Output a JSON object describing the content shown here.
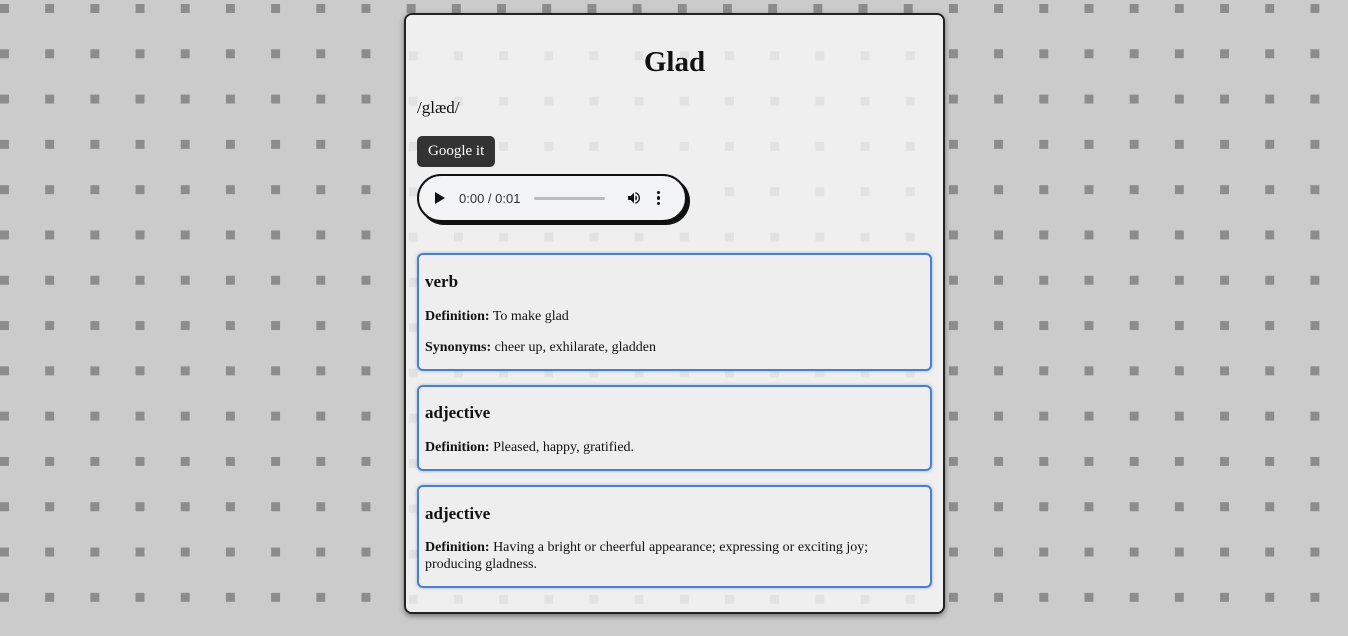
{
  "entry": {
    "word": "Glad",
    "phonetic": "/glæd/",
    "google_button": "Google it"
  },
  "audio": {
    "time": "0:00 / 0:01",
    "progress": 0.0
  },
  "meanings": [
    {
      "part_of_speech": "verb",
      "definition_label": "Definition:",
      "definition": "To make glad",
      "synonyms_label": "Synonyms:",
      "synonyms": "cheer up, exhilarate, gladden"
    },
    {
      "part_of_speech": "adjective",
      "definition_label": "Definition:",
      "definition": "Pleased, happy, gratified."
    },
    {
      "part_of_speech": "adjective",
      "definition_label": "Definition:",
      "definition": "Having a bright or cheerful appearance; expressing or exciting joy; producing gladness."
    }
  ],
  "colors": {
    "background": "#cbcbcb",
    "pattern": "#8c8c8c",
    "card": "#efefef",
    "meaning_border": "#4a7fd0",
    "button": "#333333"
  }
}
